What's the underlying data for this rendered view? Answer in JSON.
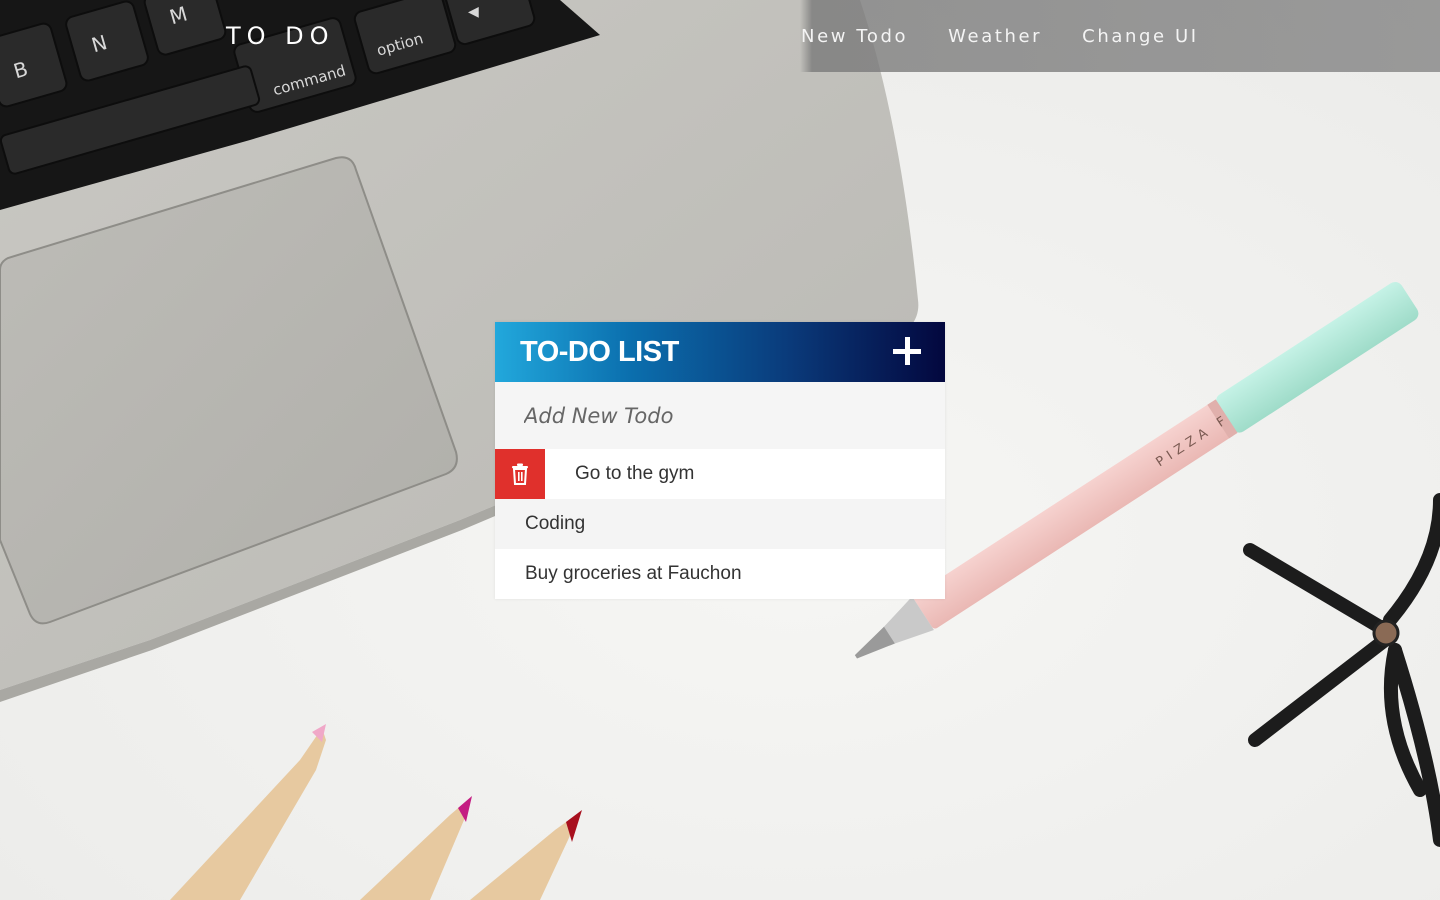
{
  "brand": {
    "title": "TO DO"
  },
  "nav": {
    "items": [
      {
        "label": "New Todo"
      },
      {
        "label": "Weather"
      },
      {
        "label": "Change UI"
      }
    ]
  },
  "todo": {
    "title": "TO-DO LIST",
    "add_icon": "plus-icon",
    "input_placeholder": "Add New Todo",
    "input_value": "",
    "items": [
      {
        "text": "Go to the gym",
        "hovered": true,
        "delete_icon": "trash-icon"
      },
      {
        "text": "Coding"
      },
      {
        "text": "Buy groceries at Fauchon"
      }
    ]
  },
  "background": {
    "keyboard_keys": [
      "B",
      "N",
      "M",
      "command",
      "option"
    ],
    "pen_text": "PIZZA F"
  },
  "colors": {
    "header_gradient": [
      "#22a8dc",
      "#03073e"
    ],
    "delete": "#e0302c",
    "nav_bar": "#8a8a8a"
  }
}
